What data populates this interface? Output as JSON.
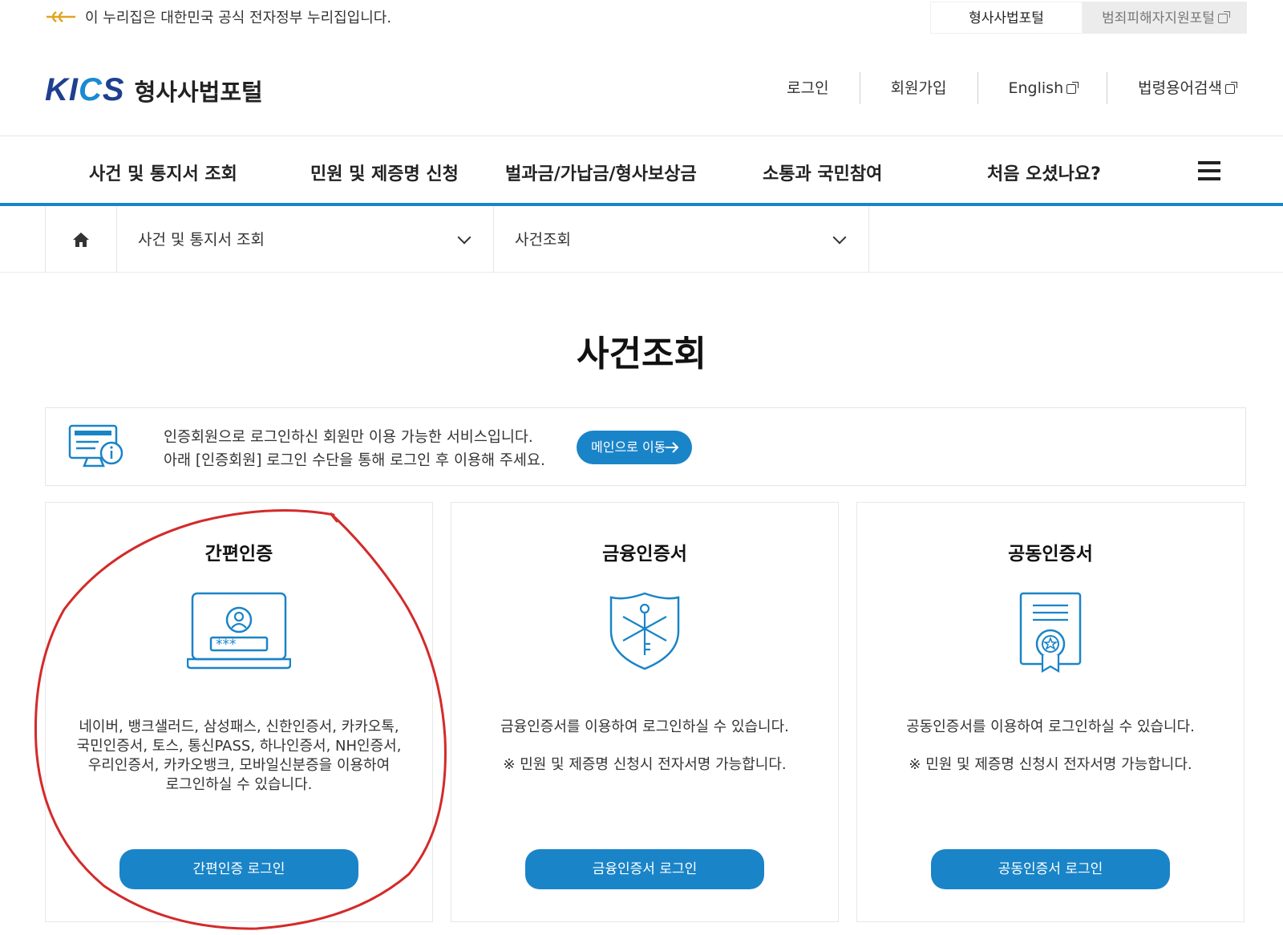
{
  "gov_bar": {
    "notice": "이 누리집은 대한민국 공식 전자정부 누리집입니다.",
    "tabs": [
      "형사사법포털",
      "범죄피해자지원포털"
    ]
  },
  "header": {
    "logo_mark": "KICS",
    "logo_text": "형사사법포털",
    "util_links": [
      "로그인",
      "회원가입",
      "English",
      "법령용어검색"
    ]
  },
  "gnb": {
    "items": [
      "사건 및 통지서 조회",
      "민원 및 제증명 신청",
      "벌과금/가납금/형사보상금",
      "소통과 국민참여",
      "처음 오셨나요?"
    ]
  },
  "breadcrumb": {
    "level1": "사건 및 통지서 조회",
    "level2": "사건조회"
  },
  "page": {
    "title": "사건조회"
  },
  "notice": {
    "line1": "인증회원으로 로그인하신 회원만 이용 가능한 서비스입니다.",
    "line2": "아래 [인증회원] 로그인 수단을 통해 로그인 후 이용해 주세요.",
    "button": "메인으로 이동"
  },
  "cards": [
    {
      "title": "간편인증",
      "desc": [
        "네이버, 뱅크샐러드, 삼성패스, 신한인증서, 카카오톡,",
        "국민인증서, 토스, 통신PASS, 하나인증서, NH인증서,",
        "우리인증서, 카카오뱅크, 모바일신분증을 이용하여",
        "로그인하실 수 있습니다."
      ],
      "button": "간편인증 로그인",
      "password_mask": "***"
    },
    {
      "title": "금융인증서",
      "desc": [
        "금융인증서를 이용하여 로그인하실 수 있습니다.",
        "※ 민원 및 제증명 신청시 전자서명 가능합니다."
      ],
      "button": "금융인증서 로그인"
    },
    {
      "title": "공동인증서",
      "desc": [
        "공동인증서를 이용하여 로그인하실 수 있습니다.",
        "※ 민원 및 제증명 신청시 전자서명 가능합니다."
      ],
      "button": "공동인증서 로그인"
    }
  ],
  "colors": {
    "accent": "#1a84c8",
    "logo_navy": "#1f3f8f",
    "annotation_red": "#d42a2a"
  }
}
